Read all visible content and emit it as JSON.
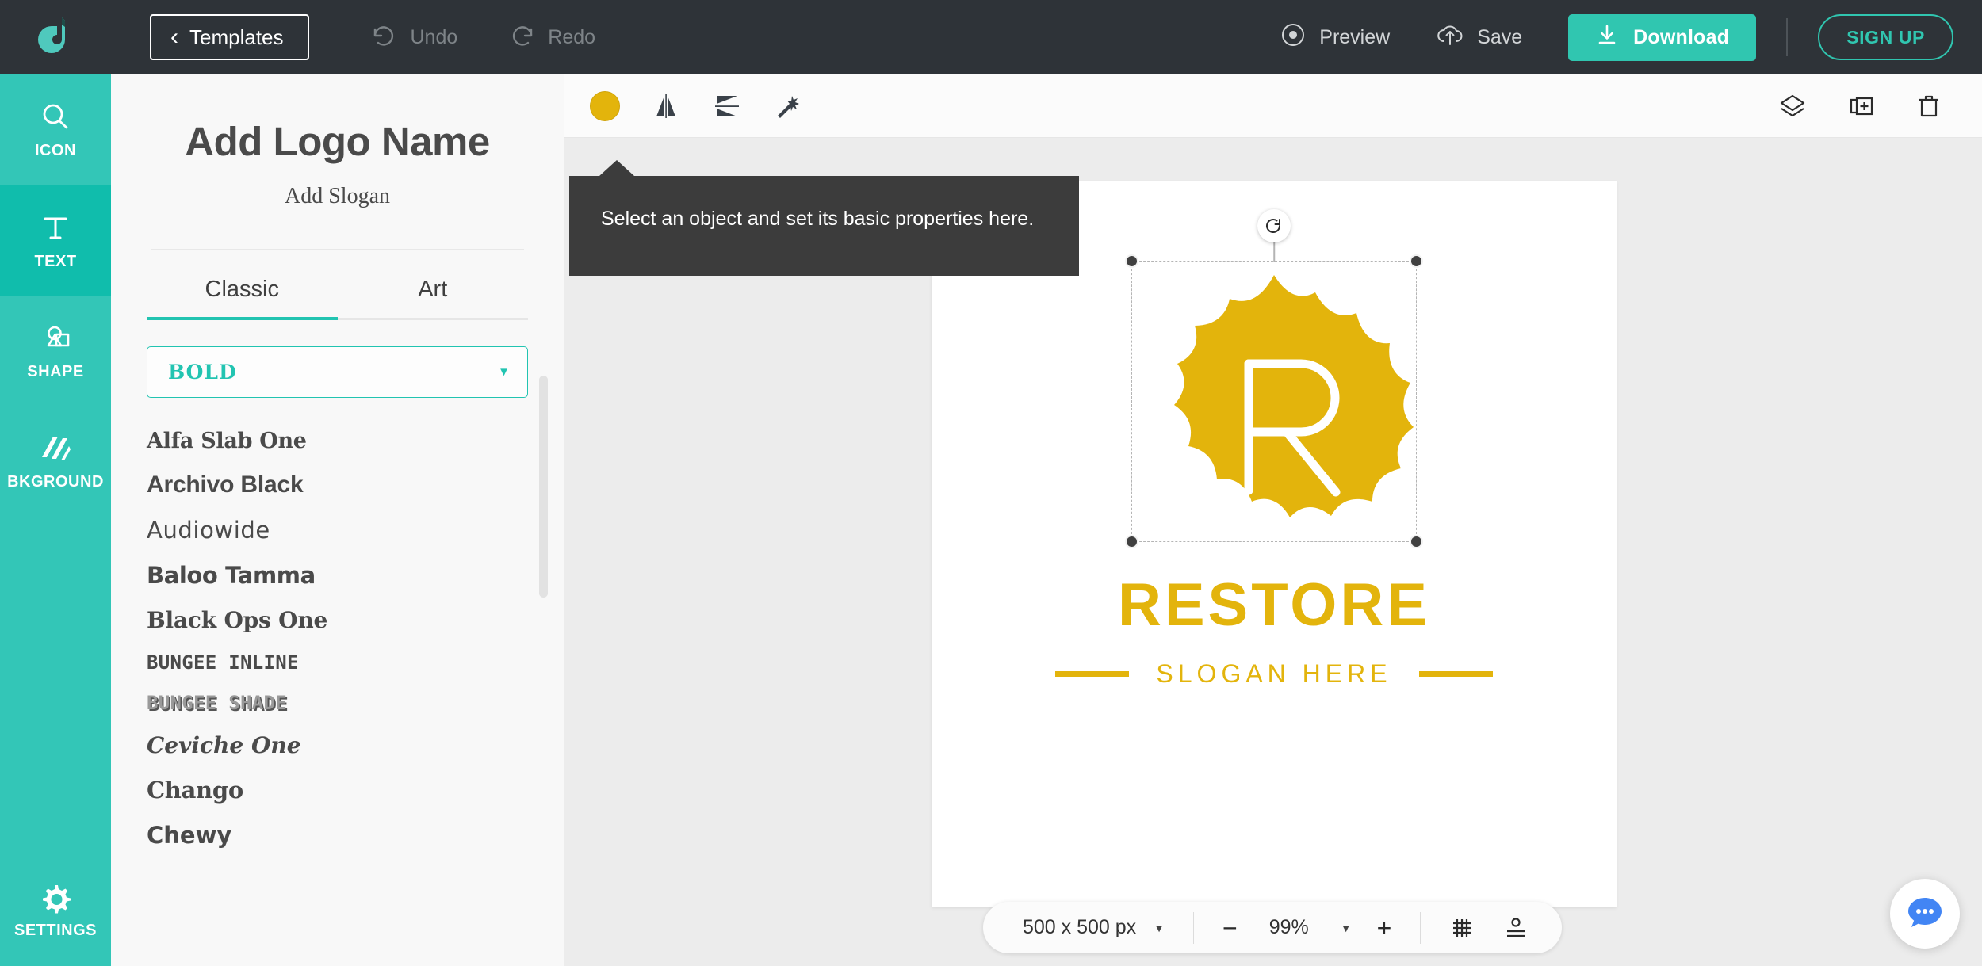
{
  "topbar": {
    "brand_icon": "logo-droplet-icon",
    "templates_label": "Templates",
    "undo_label": "Undo",
    "redo_label": "Redo",
    "preview_label": "Preview",
    "save_label": "Save",
    "download_label": "Download",
    "signup_label": "SIGN UP",
    "accent_color": "#30c6b0",
    "background_color": "#2e3338"
  },
  "sidebar": {
    "active": "TEXT",
    "accent_color": "#33c6b7",
    "active_color": "#10bdac",
    "items": [
      {
        "label": "ICON",
        "icon": "search-icon"
      },
      {
        "label": "TEXT",
        "icon": "text-t-icon"
      },
      {
        "label": "SHAPE",
        "icon": "shape-icon"
      },
      {
        "label": "BKGROUND",
        "icon": "background-hatch-icon"
      }
    ],
    "settings": {
      "label": "SETTINGS",
      "icon": "gear-icon"
    }
  },
  "panel": {
    "title": "Add Logo Name",
    "subtitle": "Add Slogan",
    "tabs": [
      {
        "label": "Classic",
        "active": true
      },
      {
        "label": "Art",
        "active": false
      }
    ],
    "tab_underline_color": "#22c4b1",
    "font_select": {
      "value": "BOLD",
      "caret_icon": "chevron-down-icon",
      "accent_color": "#22c4b1"
    },
    "fonts": [
      "Alfa Slab One",
      "Archivo Black",
      "Audiowide",
      "Baloo Tamma",
      "Black Ops One",
      "BUNGEE INLINE",
      "BUNGEE SHADE",
      "Ceviche One",
      "Chango",
      "Chewy"
    ]
  },
  "canvas_toolbar": {
    "left_tools": [
      {
        "name": "fill-color-swatch",
        "icon": "circle-swatch-icon",
        "color": "#e3b40c"
      },
      {
        "name": "flip-horizontal",
        "icon": "flip-horizontal-icon"
      },
      {
        "name": "flip-vertical",
        "icon": "flip-vertical-icon"
      },
      {
        "name": "magic-effects",
        "icon": "magic-wand-icon"
      }
    ],
    "right_tools": [
      {
        "name": "layers",
        "icon": "layers-icon"
      },
      {
        "name": "duplicate",
        "icon": "duplicate-icon"
      },
      {
        "name": "delete",
        "icon": "trash-icon"
      }
    ]
  },
  "tooltip": {
    "text": "Select an object and set its basic properties here."
  },
  "logo": {
    "mark_icon": "flower-monogram-icon",
    "monogram_letter": "R",
    "name": "RESTORE",
    "slogan": "SLOGAN HERE",
    "color": "#e3b40c",
    "selected": true,
    "rotate_icon": "rotate-icon"
  },
  "zoombar": {
    "canvas_size": "500 x 500 px",
    "size_caret_icon": "chevron-down-icon",
    "zoom_out_label": "−",
    "zoom_level": "99%",
    "zoom_caret_icon": "chevron-down-icon",
    "zoom_in_label": "+",
    "grid_icon": "grid-icon",
    "guides_icon": "guides-icon"
  },
  "chat": {
    "icon": "chat-bubble-icon",
    "color": "#4285f4"
  }
}
